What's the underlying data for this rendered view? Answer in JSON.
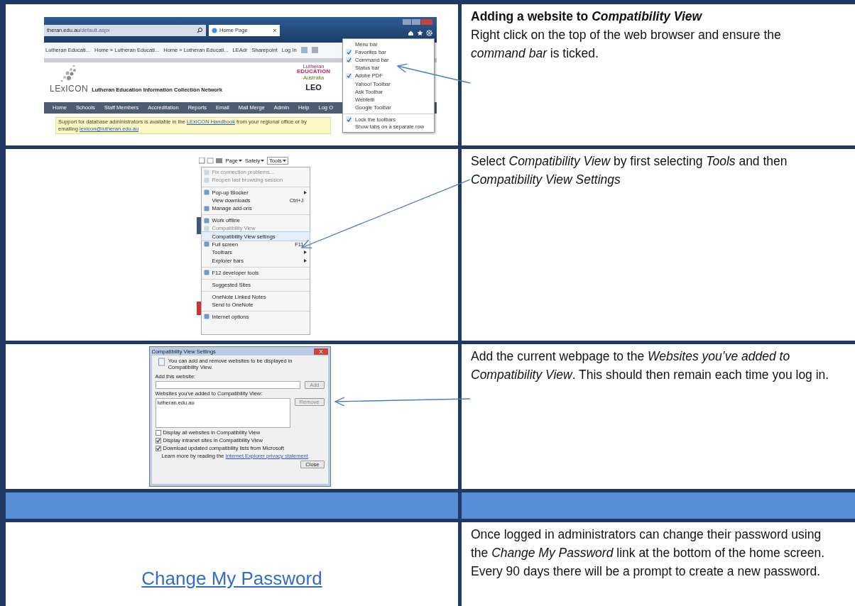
{
  "browser": {
    "address": "theran.edu.au",
    "address_path": "/default.aspx",
    "tab": "Home Page",
    "favorites": [
      "Lutheran Educati...",
      "Home » Lutheran Educati...",
      "Home » Lutheran Educati...",
      "LEAdr",
      "Sharepoint",
      "Log In"
    ],
    "logo": "LExICON",
    "tagline": "Lutheran Education Information Collection Network",
    "partner_logo": {
      "top": "Lutheran",
      "middle": "EDUCATION",
      "bottom": "Australia"
    },
    "leo_logo": "LEO",
    "nav": [
      "Home",
      "Schools",
      "Staff Members",
      "Accreditation",
      "Reports",
      "Email",
      "Mail Merge",
      "Admin",
      "Help",
      "Log O"
    ],
    "notice": {
      "before": "Support for database administrators is available in the",
      "link": "LExICON Handbook",
      "after": "from your regional office or by emailing",
      "email": "lexicon@lutheran.edu.au"
    },
    "menu": [
      {
        "label": "Menu bar",
        "checked": false,
        "separator_before": false
      },
      {
        "label": "Favorites bar",
        "checked": true,
        "separator_before": false
      },
      {
        "label": "Command bar",
        "checked": true,
        "separator_before": false
      },
      {
        "label": "Status bar",
        "checked": false,
        "separator_before": false
      },
      {
        "label": "Adobe PDF",
        "checked": true,
        "separator_before": false
      },
      {
        "label": "Yahoo! Toolbar",
        "checked": false,
        "separator_before": false
      },
      {
        "label": "Ask Toolbar",
        "checked": false,
        "separator_before": false
      },
      {
        "label": "Webfetti",
        "checked": false,
        "separator_before": false
      },
      {
        "label": "Google Toolbar",
        "checked": false,
        "separator_before": false
      },
      {
        "label": "Lock the toolbars",
        "checked": true,
        "separator_before": true
      },
      {
        "label": "Show tabs on a separate row",
        "checked": false,
        "separator_before": false
      }
    ]
  },
  "tools": {
    "toolbar": [
      "Page",
      "Safety",
      "Tools"
    ],
    "menu": [
      {
        "label": "Fix connection problems...",
        "disabled": true,
        "selected": false,
        "icon": true,
        "submenu": false,
        "separator_before": false
      },
      {
        "label": "Reopen last browsing session",
        "disabled": true,
        "selected": false,
        "icon": true,
        "submenu": false,
        "separator_before": false
      },
      {
        "label": "Pop-up Blocker",
        "disabled": false,
        "selected": false,
        "icon": true,
        "submenu": true,
        "separator_before": true
      },
      {
        "label": "View downloads",
        "shortcut": "Ctrl+J",
        "disabled": false,
        "selected": false,
        "icon": false,
        "submenu": false,
        "separator_before": false
      },
      {
        "label": "Manage add-ons",
        "disabled": false,
        "selected": false,
        "icon": true,
        "submenu": false,
        "separator_before": false
      },
      {
        "label": "Work offline",
        "disabled": false,
        "selected": false,
        "icon": true,
        "submenu": false,
        "separator_before": true
      },
      {
        "label": "Compatibility View",
        "disabled": true,
        "selected": false,
        "icon": true,
        "submenu": false,
        "separator_before": false
      },
      {
        "label": "Compatibility View settings",
        "disabled": false,
        "selected": true,
        "icon": false,
        "submenu": false,
        "separator_before": false
      },
      {
        "label": "Full screen",
        "shortcut": "F11",
        "disabled": false,
        "selected": false,
        "icon": true,
        "submenu": false,
        "separator_before": false
      },
      {
        "label": "Toolbars",
        "disabled": false,
        "selected": false,
        "icon": false,
        "submenu": true,
        "separator_before": false
      },
      {
        "label": "Explorer bars",
        "disabled": false,
        "selected": false,
        "icon": false,
        "submenu": true,
        "separator_before": false
      },
      {
        "label": "F12 developer tools",
        "disabled": false,
        "selected": false,
        "icon": true,
        "submenu": false,
        "separator_before": true
      },
      {
        "label": "Suggested Sites",
        "disabled": false,
        "selected": false,
        "icon": false,
        "submenu": false,
        "separator_before": true
      },
      {
        "label": "OneNote Linked Notes",
        "disabled": false,
        "selected": false,
        "icon": false,
        "submenu": false,
        "separator_before": true
      },
      {
        "label": "Send to OneNote",
        "disabled": false,
        "selected": false,
        "icon": false,
        "submenu": false,
        "separator_before": false
      },
      {
        "label": "Internet options",
        "disabled": false,
        "selected": false,
        "icon": true,
        "submenu": false,
        "separator_before": true
      }
    ]
  },
  "dialog": {
    "title": "Compatibility View Settings",
    "intro": "You can add and remove websites to be displayed in Compatibility View.",
    "add_label": "Add this website:",
    "add_button": "Add",
    "list_label": "Websites you've added to Compatibility View:",
    "sites": [
      "lutheran.edu.au"
    ],
    "remove_button": "Remove",
    "options": [
      {
        "label": "Display all websites in Compatibility View",
        "checked": false
      },
      {
        "label": "Display intranet sites in Compatibility View",
        "checked": true
      },
      {
        "label": "Download updated compatibility lists from Microsoft",
        "checked": true
      }
    ],
    "learn_before": "Learn more by reading the",
    "learn_link": "Internet Explorer privacy statement",
    "close_button": "Close"
  },
  "steps": [
    {
      "kind": "toolbars",
      "heading": "Adding a website to *Compatibility View*",
      "text": "Right click on the top of the web browser and ensure the *command bar* is ticked."
    },
    {
      "kind": "tools_menu",
      "text": "Select *Compatibility View* by first selecting *Tools* and then *Compatibility View Settings*"
    },
    {
      "kind": "dialog",
      "text": "Add the current webpage to the *Websites you’ve added to Compatibility View*. This should then remain each time you log in."
    },
    {
      "kind": "band"
    },
    {
      "kind": "link",
      "link": "Change My Password",
      "text": "Once logged in administrators can change their password using the *Change My Password* link at the bottom of the home screen. Every 90 days there will be a prompt to create a new password."
    }
  ]
}
